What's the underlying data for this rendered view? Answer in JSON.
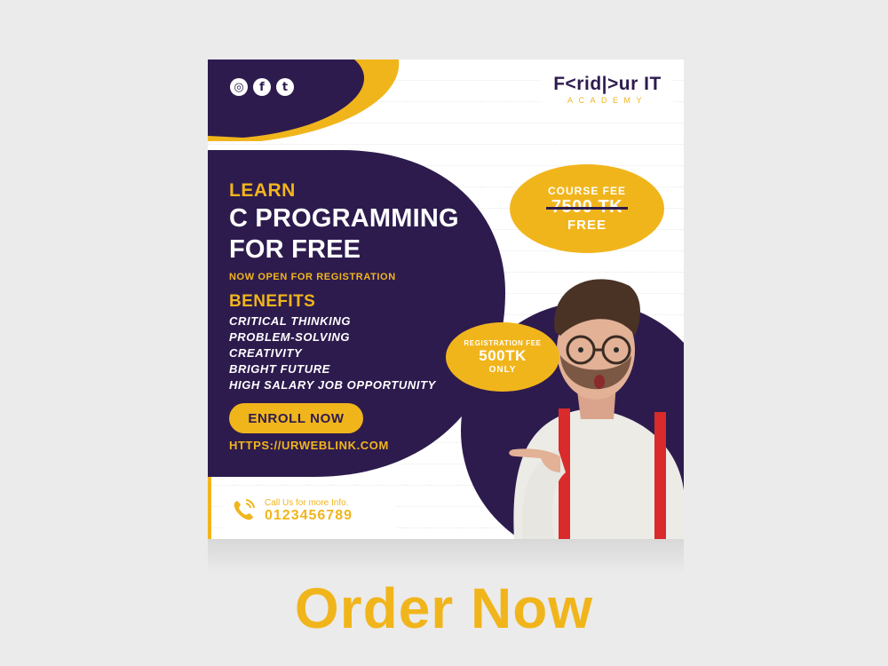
{
  "brand": {
    "name": "F<rid|>ur IT",
    "sub": "ACADEMY"
  },
  "social": [
    {
      "icon": "instagram-icon",
      "glyph": "◎"
    },
    {
      "icon": "facebook-icon",
      "glyph": "f"
    },
    {
      "icon": "twitter-icon",
      "glyph": "t"
    }
  ],
  "headline": {
    "learn": "LEARN",
    "line1": "C PROGRAMMING",
    "line2": "FOR FREE",
    "open": "NOW OPEN FOR REGISTRATION"
  },
  "benefits": {
    "heading": "BENEFITS",
    "items": [
      "CRITICAL THINKING",
      "PROBLEM-SOLVING",
      "CREATIVITY",
      "BRIGHT FUTURE",
      "HIGH SALARY JOB OPPORTUNITY"
    ]
  },
  "cta": {
    "enroll": "ENROLL NOW",
    "url": "HTTPS://URWEBLINK.COM"
  },
  "course_fee": {
    "label": "COURSE FEE",
    "old_price": "7500 TK",
    "new_price": "FREE"
  },
  "registration_fee": {
    "label": "REGISTRATION FEE",
    "price": "500TK",
    "note": "ONLY"
  },
  "contact": {
    "label": "Call Us for more Info.",
    "phone": "0123456789"
  },
  "order_button": "Order Now",
  "colors": {
    "purple": "#2d1b4e",
    "yellow": "#f1b51c",
    "background": "#ebebeb"
  }
}
